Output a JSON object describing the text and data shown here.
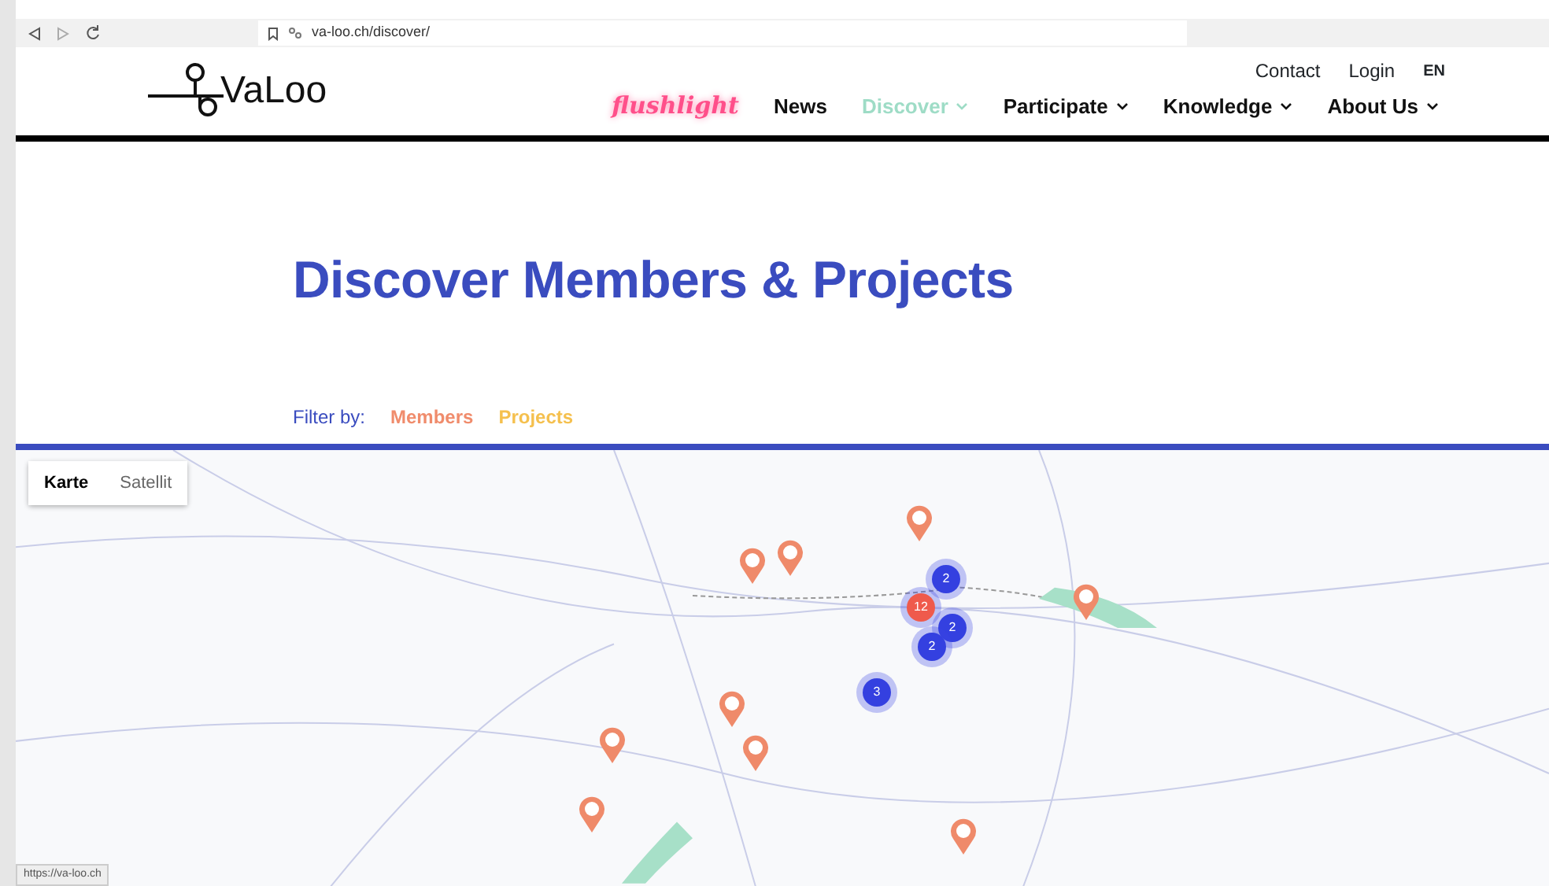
{
  "browser": {
    "url": "va-loo.ch/discover/",
    "status_url": "https://va-loo.ch"
  },
  "header": {
    "logo": "VaLoo",
    "top_links": [
      {
        "label": "Contact"
      },
      {
        "label": "Login"
      },
      {
        "label": "EN"
      }
    ],
    "nav": [
      {
        "label": "flushlight",
        "kind": "neon",
        "dropdown": false,
        "selected": false
      },
      {
        "label": "News",
        "kind": "link",
        "dropdown": false,
        "selected": false
      },
      {
        "label": "Discover",
        "kind": "link",
        "dropdown": true,
        "selected": true
      },
      {
        "label": "Participate",
        "kind": "link",
        "dropdown": true,
        "selected": false
      },
      {
        "label": "Knowledge",
        "kind": "link",
        "dropdown": true,
        "selected": false
      },
      {
        "label": "About Us",
        "kind": "link",
        "dropdown": true,
        "selected": false
      }
    ]
  },
  "title": "Discover Members & Projects",
  "filter": {
    "label": "Filter by:",
    "options": [
      {
        "label": "Members",
        "color": "#f08c6c"
      },
      {
        "label": "Projects",
        "color": "#f5c04e"
      }
    ]
  },
  "map": {
    "tabs": [
      {
        "label": "Karte",
        "selected": true
      },
      {
        "label": "Satellit",
        "selected": false
      }
    ],
    "markers": [
      {
        "kind": "pin"
      },
      {
        "kind": "pin"
      },
      {
        "kind": "pin"
      },
      {
        "kind": "pin"
      },
      {
        "kind": "pin"
      },
      {
        "kind": "pin"
      },
      {
        "kind": "pin"
      },
      {
        "kind": "pin"
      },
      {
        "kind": "pin"
      },
      {
        "kind": "cluster",
        "count": "2",
        "color": "#3440e0"
      },
      {
        "kind": "cluster",
        "count": "12",
        "color": "#ef5a4c"
      },
      {
        "kind": "cluster",
        "count": "2",
        "color": "#3440e0"
      },
      {
        "kind": "cluster",
        "count": "2",
        "color": "#3440e0"
      },
      {
        "kind": "cluster",
        "count": "3",
        "color": "#3440e0"
      }
    ]
  }
}
